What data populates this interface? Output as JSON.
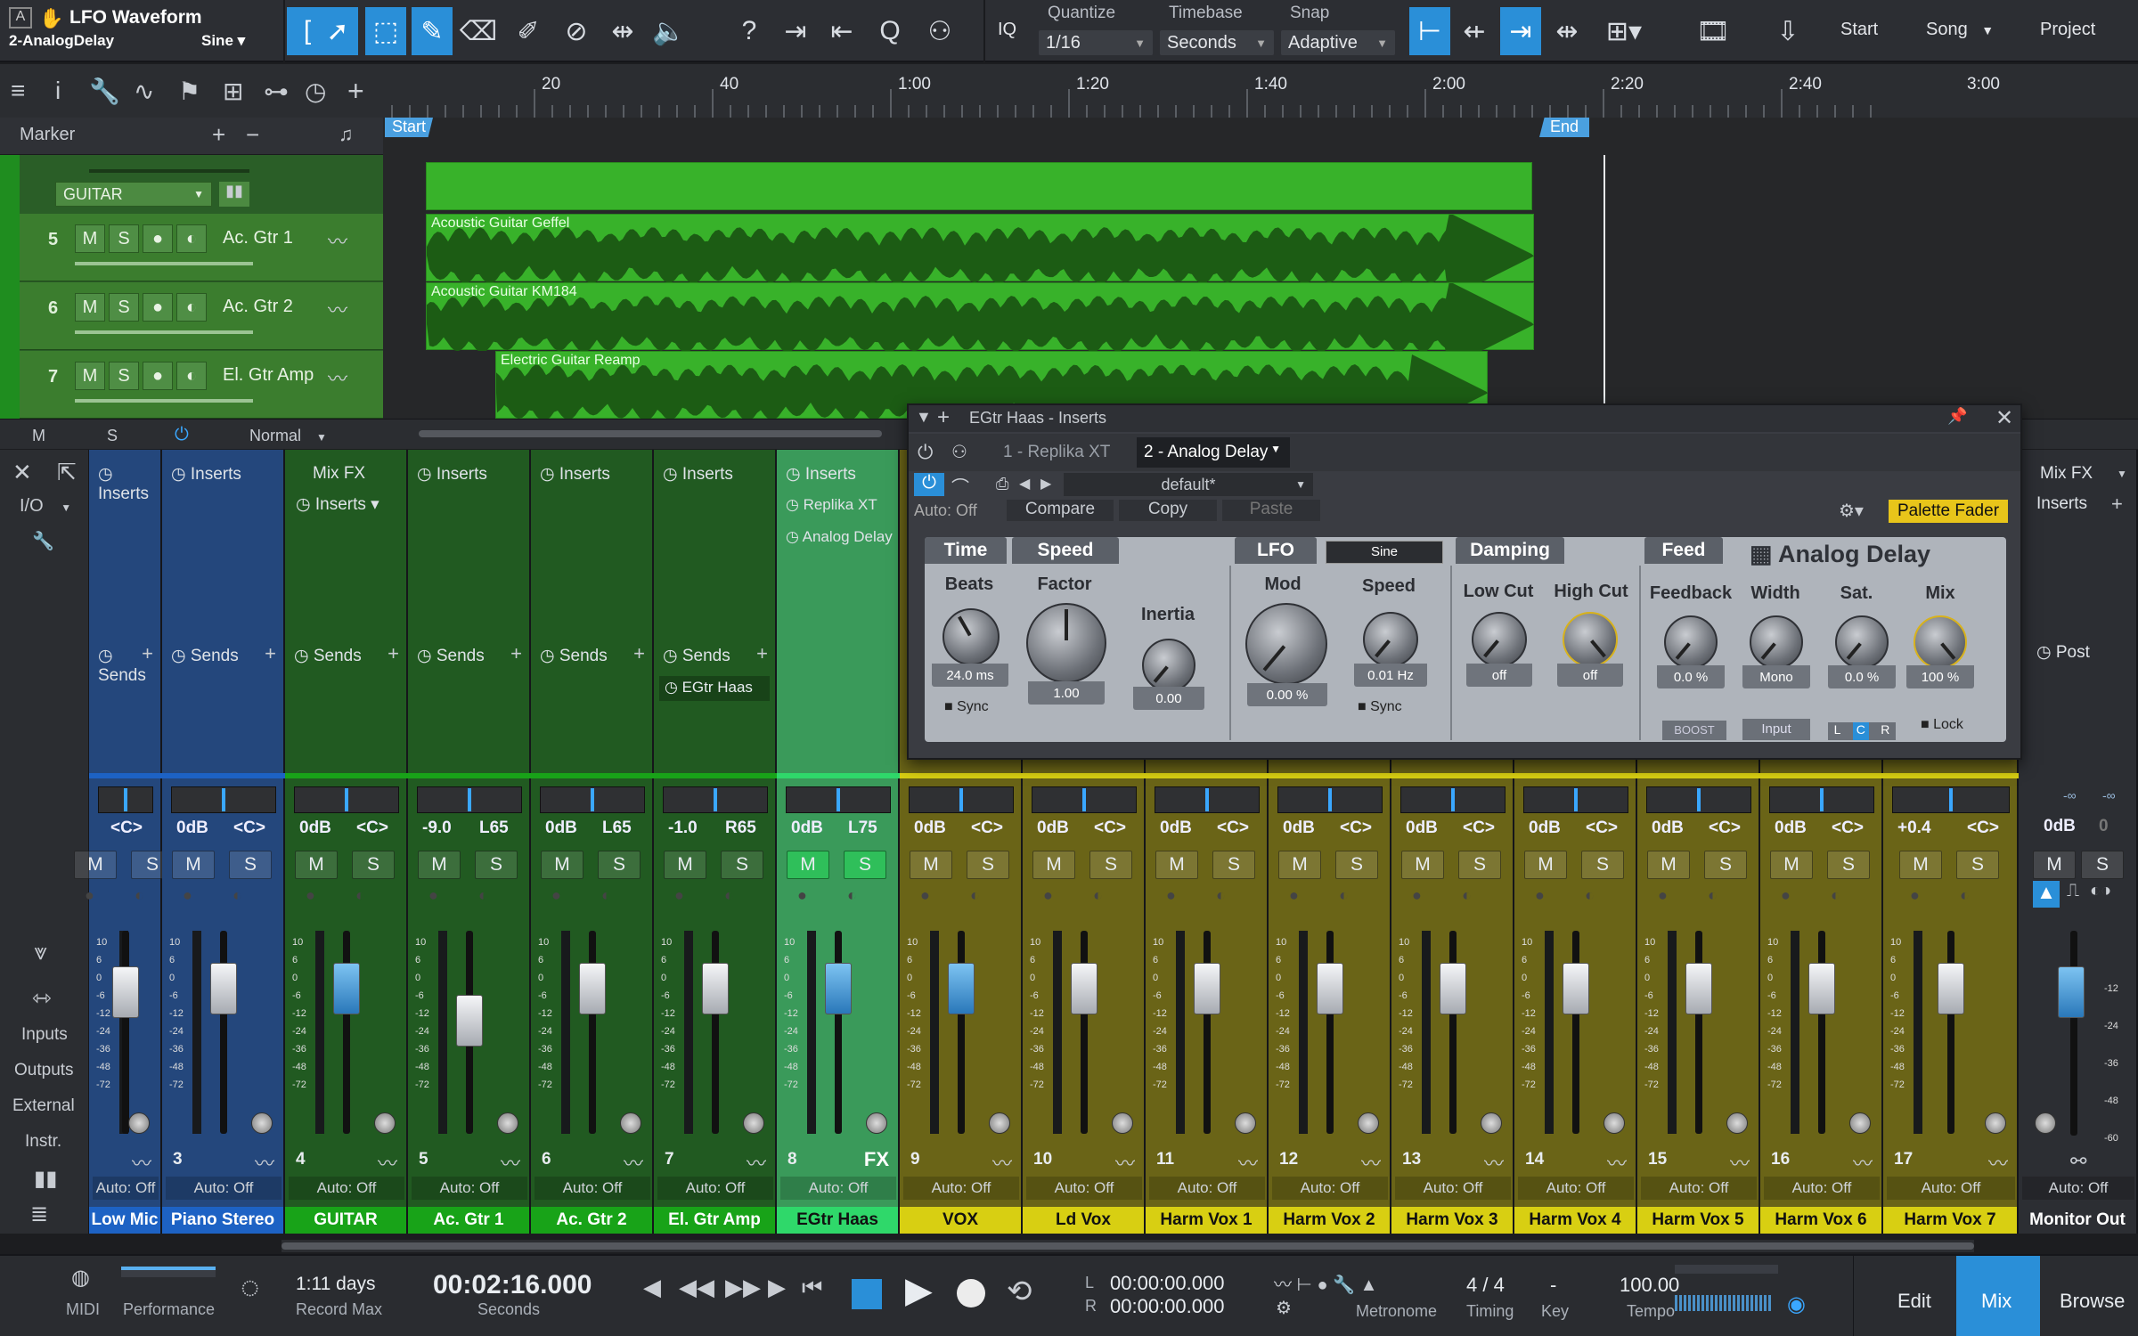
{
  "song": {
    "title": "LFO Waveform",
    "track": "2-AnalogDelay",
    "wave": "Sine"
  },
  "toolbar": {
    "iq": "IQ",
    "quantize_label": "Quantize",
    "quantize_value": "1/16",
    "timebase_label": "Timebase",
    "timebase_value": "Seconds",
    "snap_label": "Snap",
    "snap_value": "Adaptive",
    "start": "Start",
    "song": "Song",
    "project": "Project"
  },
  "ruler": {
    "ticks": [
      "20",
      "40",
      "1:00",
      "1:20",
      "1:40",
      "2:00",
      "2:20",
      "2:40",
      "3:00"
    ],
    "start": "Start",
    "end": "End"
  },
  "marker": {
    "label": "Marker",
    "plus": "+",
    "minus": "−"
  },
  "folder": {
    "name": "GUITAR"
  },
  "tracks": [
    {
      "num": "5",
      "name": "Ac. Gtr 1",
      "clip": "Acoustic Guitar Geffel"
    },
    {
      "num": "6",
      "name": "Ac. Gtr 2",
      "clip": "Acoustic Guitar KM184"
    },
    {
      "num": "7",
      "name": "El. Gtr Amp",
      "clip": "Electric Guitar Reamp"
    }
  ],
  "trackFooter": {
    "m": "M",
    "s": "S",
    "mode": "Normal"
  },
  "mixerLeft": {
    "io": "I/O",
    "inputs": "Inputs",
    "outputs": "Outputs",
    "external": "External",
    "instr": "Instr."
  },
  "labels": {
    "inserts": "Inserts",
    "sends": "Sends",
    "mixfx": "Mix FX",
    "autooff": "Auto: Off",
    "m": "M",
    "s": "S",
    "fx": "FX",
    "post": "Post"
  },
  "channels": [
    {
      "num": "",
      "name": "Low Mic",
      "gain": "",
      "pan": "<C>",
      "color": "#1d62c4",
      "bg": "#24477c"
    },
    {
      "num": "3",
      "name": "Piano Stereo",
      "gain": "0dB",
      "pan": "<C>",
      "color": "#1d62c4",
      "bg": "#24477c"
    },
    {
      "num": "4",
      "name": "GUITAR",
      "gain": "0dB",
      "pan": "<C>",
      "color": "#18a318",
      "bg": "#215a21"
    },
    {
      "num": "5",
      "name": "Ac. Gtr 1",
      "gain": "-9.0",
      "pan": "L65",
      "color": "#18a318",
      "bg": "#215a21"
    },
    {
      "num": "6",
      "name": "Ac. Gtr 2",
      "gain": "0dB",
      "pan": "L65",
      "color": "#18a318",
      "bg": "#215a21"
    },
    {
      "num": "7",
      "name": "El. Gtr Amp",
      "gain": "-1.0",
      "pan": "R65",
      "color": "#18a318",
      "bg": "#215a21"
    },
    {
      "num": "8",
      "name": "EGtr Haas",
      "gain": "0dB",
      "pan": "L75",
      "color": "#2fd86a",
      "bg": "#3a9a5a"
    },
    {
      "num": "9",
      "name": "VOX",
      "gain": "0dB",
      "pan": "<C>",
      "color": "#d8cf12",
      "bg": "#6a6417"
    },
    {
      "num": "10",
      "name": "Ld Vox",
      "gain": "0dB",
      "pan": "<C>",
      "color": "#d8cf12",
      "bg": "#6a6417"
    },
    {
      "num": "11",
      "name": "Harm Vox 1",
      "gain": "0dB",
      "pan": "<C>",
      "color": "#d8cf12",
      "bg": "#6a6417"
    },
    {
      "num": "12",
      "name": "Harm Vox 2",
      "gain": "0dB",
      "pan": "<C>",
      "color": "#d8cf12",
      "bg": "#6a6417"
    },
    {
      "num": "13",
      "name": "Harm Vox 3",
      "gain": "0dB",
      "pan": "<C>",
      "color": "#d8cf12",
      "bg": "#6a6417"
    },
    {
      "num": "14",
      "name": "Harm Vox 4",
      "gain": "0dB",
      "pan": "<C>",
      "color": "#d8cf12",
      "bg": "#6a6417"
    },
    {
      "num": "15",
      "name": "Harm Vox 5",
      "gain": "0dB",
      "pan": "<C>",
      "color": "#d8cf12",
      "bg": "#6a6417"
    },
    {
      "num": "16",
      "name": "Harm Vox 6",
      "gain": "0dB",
      "pan": "<C>",
      "color": "#d8cf12",
      "bg": "#6a6417"
    },
    {
      "num": "17",
      "name": "Harm Vox 7",
      "gain": "+0.4",
      "pan": "<C>",
      "color": "#d8cf12",
      "bg": "#6a6417"
    }
  ],
  "sendChain": {
    "inserts": "Inserts",
    "replika": "Replika XT",
    "analog": "Analog Delay",
    "send": "EGtr Haas"
  },
  "monitor": {
    "name": "Monitor Out",
    "gain": "0dB",
    "gain2": "0",
    "db1": "-∞",
    "db2": "-∞"
  },
  "scaleMarks": [
    "10",
    "6",
    "0",
    "-6",
    "-12",
    "-24",
    "-36",
    "-48",
    "-72"
  ],
  "monitorScale": [
    "-12",
    "-24",
    "-36",
    "-48",
    "-60"
  ],
  "plugin": {
    "title": "EGtr Haas - Inserts",
    "tab1": "1 - Replika XT",
    "tab2": "2 - Analog Delay",
    "preset": "default*",
    "autooff": "Auto: Off",
    "compare": "Compare",
    "copy": "Copy",
    "paste": "Paste",
    "palette": "Palette Fader",
    "logo": "Analog Delay",
    "time": {
      "head": "Time",
      "beats": "Beats",
      "beats_val": "24.0 ms",
      "sync": "Sync"
    },
    "speed": {
      "head": "Speed",
      "factor": "Factor",
      "factor_val": "1.00",
      "inertia": "Inertia",
      "inertia_val": "0.00"
    },
    "lfo": {
      "head": "LFO",
      "wave": "Sine",
      "mod": "Mod",
      "mod_val": "0.00 %",
      "speed": "Speed",
      "speed_val": "0.01 Hz",
      "sync": "Sync"
    },
    "damping": {
      "head": "Damping",
      "lowcut": "Low Cut",
      "lowcut_val": "off",
      "highcut": "High Cut",
      "highcut_val": "off"
    },
    "feed": {
      "head": "Feed",
      "feedback": "Feedback",
      "feedback_val": "0.0 %",
      "boost": "BOOST",
      "width": "Width",
      "width_val": "Mono",
      "input": "Input",
      "sat": "Sat.",
      "sat_val": "0.0 %",
      "mix": "Mix",
      "mix_val": "100 %",
      "lock": "Lock",
      "l": "L",
      "c": "C",
      "r": "R"
    }
  },
  "transport": {
    "midi": "MIDI",
    "performance": "Performance",
    "days": "1:11 days",
    "recordmax": "Record Max",
    "time": "00:02:16.000",
    "seconds": "Seconds",
    "l": "L",
    "r": "R",
    "ltime": "00:00:00.000",
    "rtime": "00:00:00.000",
    "metronome": "Metronome",
    "timesig": "4 / 4",
    "timing": "Timing",
    "key": "-",
    "keylbl": "Key",
    "tempo": "100.00",
    "tempolbl": "Tempo",
    "edit": "Edit",
    "mix": "Mix",
    "browse": "Browse"
  }
}
